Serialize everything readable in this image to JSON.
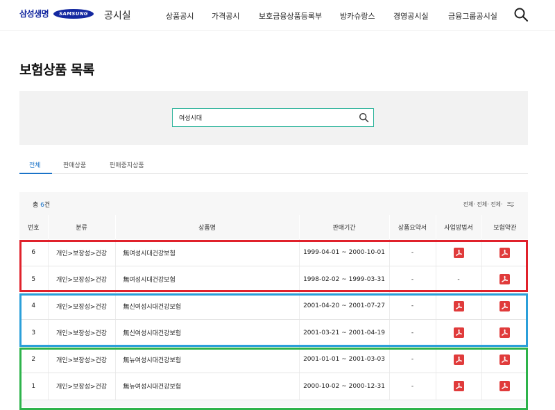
{
  "header": {
    "logo_text": "삼성생명",
    "samsung_text": "SAMSUNG",
    "site_title": "공시실",
    "nav": [
      "상품공시",
      "가격공시",
      "보호금융상품등록부",
      "방카슈랑스",
      "경영공시실",
      "금융그룹공시실"
    ]
  },
  "page_title": "보험상품 목록",
  "search": {
    "value": "여성시대",
    "placeholder": ""
  },
  "tabs": [
    {
      "label": "전체",
      "active": true
    },
    {
      "label": "판매상품",
      "active": false
    },
    {
      "label": "판매중지상품",
      "active": false
    }
  ],
  "summary": {
    "prefix": "총 ",
    "count": "6",
    "suffix": "건"
  },
  "filter_text": "전체· 전체· 전체·",
  "columns": [
    "번호",
    "분류",
    "상품명",
    "판매기간",
    "상품요약서",
    "사업방법서",
    "보험약관"
  ],
  "rows": [
    {
      "no": "6",
      "category": "개인>보장성>건강",
      "name": "無여성시대건강보험",
      "period": "1999-04-01 ~ 2000-10-01",
      "summary": "-",
      "method": "pdf",
      "terms": "pdf"
    },
    {
      "no": "5",
      "category": "개인>보장성>건강",
      "name": "無여성시대건강보험",
      "period": "1998-02-02 ~ 1999-03-31",
      "summary": "-",
      "method": "-",
      "terms": "pdf"
    },
    {
      "no": "4",
      "category": "개인>보장성>건강",
      "name": "無신여성시대건강보험",
      "period": "2001-04-20 ~ 2001-07-27",
      "summary": "-",
      "method": "pdf",
      "terms": "pdf"
    },
    {
      "no": "3",
      "category": "개인>보장성>건강",
      "name": "無신여성시대건강보험",
      "period": "2001-03-21 ~ 2001-04-19",
      "summary": "-",
      "method": "pdf",
      "terms": "pdf"
    },
    {
      "no": "2",
      "category": "개인>보장성>건강",
      "name": "無뉴여성시대건강보험",
      "period": "2001-01-01 ~ 2001-03-03",
      "summary": "-",
      "method": "pdf",
      "terms": "pdf"
    },
    {
      "no": "1",
      "category": "개인>보장성>건강",
      "name": "無뉴여성시대건강보험",
      "period": "2000-10-02 ~ 2000-12-31",
      "summary": "-",
      "method": "pdf",
      "terms": "pdf"
    }
  ],
  "highlight_colors": {
    "red": "#e0212b",
    "blue": "#2b9fd9",
    "green": "#2db34a"
  },
  "icons": {
    "search": "search-icon",
    "pdf": "pdf-icon",
    "filter": "sort-filter-icon"
  }
}
